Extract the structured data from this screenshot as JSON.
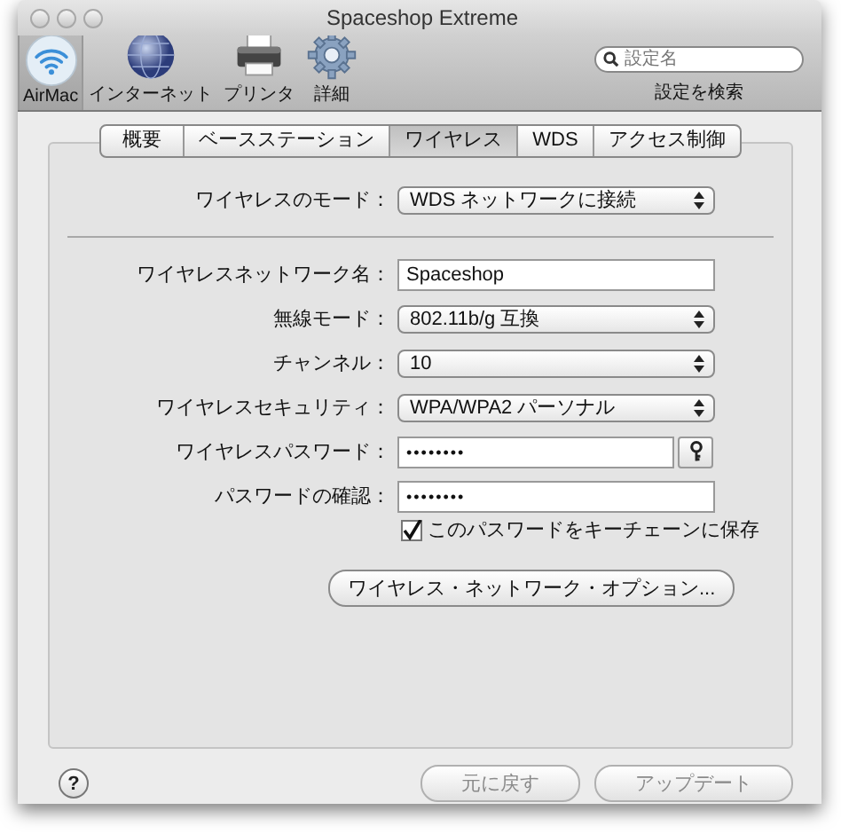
{
  "window": {
    "title": "Spaceshop Extreme"
  },
  "toolbar": {
    "items": [
      {
        "label": "AirMac",
        "kind": "wifi",
        "selected": true
      },
      {
        "label": "インターネット",
        "kind": "globe",
        "selected": false
      },
      {
        "label": "プリンタ",
        "kind": "printer",
        "selected": false
      },
      {
        "label": "詳細",
        "kind": "gear",
        "selected": false
      }
    ]
  },
  "search": {
    "placeholder": "設定名",
    "label": "設定を検索"
  },
  "tabs": [
    {
      "label": "概要",
      "selected": false
    },
    {
      "label": "ベースステーション",
      "selected": false
    },
    {
      "label": "ワイヤレス",
      "selected": true
    },
    {
      "label": "WDS",
      "selected": false
    },
    {
      "label": "アクセス制御",
      "selected": false
    }
  ],
  "mode_row": {
    "label": "ワイヤレスのモード：",
    "kind": "popup",
    "value": "WDS ネットワークに接続"
  },
  "rows": [
    {
      "label": "ワイヤレスネットワーク名：",
      "kind": "text",
      "value": "Spaceshop"
    },
    {
      "label": "無線モード：",
      "kind": "popup",
      "value": "802.11b/g 互換"
    },
    {
      "label": "チャンネル：",
      "kind": "popup",
      "value": "10"
    },
    {
      "label": "ワイヤレスセキュリティ：",
      "kind": "popup",
      "value": "WPA/WPA2 パーソナル"
    },
    {
      "label": "ワイヤレスパスワード：",
      "kind": "password",
      "value": "••••••••",
      "key_button": true
    },
    {
      "label": "パスワードの確認：",
      "kind": "password",
      "value": "••••••••",
      "key_button": false
    }
  ],
  "keychain_checkbox": {
    "label": "このパスワードをキーチェーンに保存",
    "checked": true
  },
  "options_button": {
    "label": "ワイヤレス・ネットワーク・オプション..."
  },
  "help_button": {
    "label": "?"
  },
  "footer_buttons": [
    {
      "label": "元に戻す",
      "disabled": true
    },
    {
      "label": "アップデート",
      "disabled": true
    }
  ]
}
